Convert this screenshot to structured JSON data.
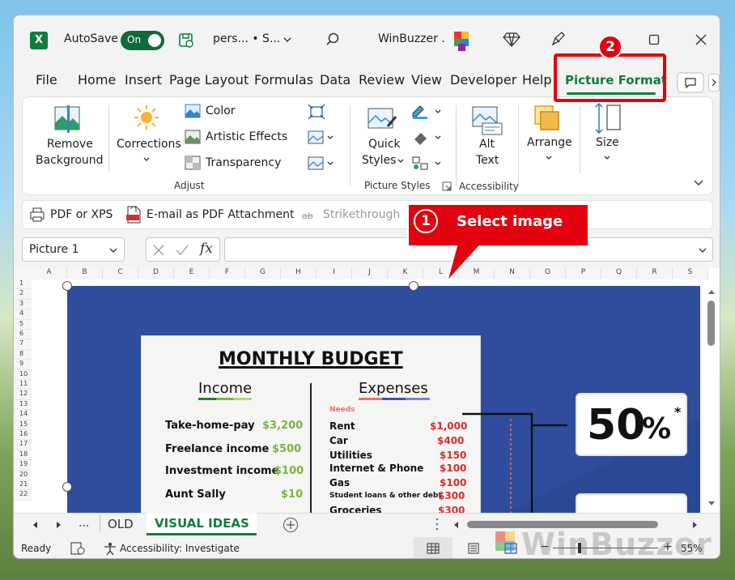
{
  "titlebar": {
    "app_icon": "X",
    "autosave_label": "AutoSave",
    "autosave_state": "On",
    "filename": "pers... • S...",
    "account": "WinBuzzer ."
  },
  "tabs": [
    {
      "label": "File"
    },
    {
      "label": "Home"
    },
    {
      "label": "Insert"
    },
    {
      "label": "Page Layout"
    },
    {
      "label": "Formulas"
    },
    {
      "label": "Data"
    },
    {
      "label": "Review"
    },
    {
      "label": "View"
    },
    {
      "label": "Developer"
    },
    {
      "label": "Help"
    },
    {
      "label": "Picture Format",
      "active": true
    }
  ],
  "ribbon": {
    "remove_background_1": "Remove",
    "remove_background_2": "Background",
    "corrections": "Corrections",
    "color": "Color",
    "artistic_effects": "Artistic Effects",
    "transparency": "Transparency",
    "group_adjust": "Adjust",
    "quick_styles_1": "Quick",
    "quick_styles_2": "Styles",
    "group_picture_styles": "Picture Styles",
    "alt_text_1": "Alt",
    "alt_text_2": "Text",
    "group_accessibility": "Accessibility",
    "arrange": "Arrange",
    "size": "Size"
  },
  "qat": {
    "pdf_xps": "PDF or XPS",
    "email_pdf": "E-mail as PDF Attachment",
    "strikethrough": "Strikethrough"
  },
  "formula_bar": {
    "name_box": "Picture 1",
    "fx": "fx",
    "value": ""
  },
  "grid": {
    "columns": [
      "A",
      "B",
      "C",
      "D",
      "E",
      "F",
      "G",
      "H",
      "I",
      "J",
      "K",
      "L",
      "M",
      "N",
      "O",
      "P",
      "Q",
      "R",
      "S"
    ],
    "rows": [
      "1",
      "2",
      "3",
      "4",
      "5",
      "6",
      "7",
      "8",
      "9",
      "10",
      "11",
      "12",
      "13",
      "14",
      "15",
      "16",
      "17",
      "18",
      "19",
      "20",
      "21",
      "22"
    ]
  },
  "image": {
    "title": "MONTHLY BUDGET",
    "income_header": "Income",
    "expenses_header": "Expenses",
    "needs_label": "Needs",
    "income": [
      {
        "label": "Take-home-pay",
        "value": "$3,200"
      },
      {
        "label": "Freelance income",
        "value": "$500"
      },
      {
        "label": "Investment income",
        "value": "$100"
      },
      {
        "label": "Aunt Sally",
        "value": "$10"
      }
    ],
    "expenses": [
      {
        "label": "Rent",
        "value": "$1,000"
      },
      {
        "label": "Car",
        "value": "$400"
      },
      {
        "label": "Utilities",
        "value": "$150"
      },
      {
        "label": "Internet & Phone",
        "value": "$100"
      },
      {
        "label": "Gas",
        "value": "$100"
      },
      {
        "label": "Student loans & other debt",
        "value": "$300"
      },
      {
        "label": "Groceries",
        "value": "$300"
      }
    ],
    "pct_main": "50",
    "pct_sym": "%",
    "pct_star": "*"
  },
  "annotations": {
    "step1_num": "1",
    "step1_text": "Select image",
    "step2_num": "2"
  },
  "sheet_tabs": {
    "ellipsis": "...",
    "tab1": "OLD",
    "tab2": "VISUAL IDEAS",
    "add": "+"
  },
  "status": {
    "ready": "Ready",
    "accessibility": "Accessibility: Investigate",
    "zoom": "55%",
    "minus": "−",
    "plus": "+"
  },
  "watermark": "WinBuzzer",
  "colors": {
    "excel_green": "#107c41",
    "annotation_red": "#e3000f",
    "poster_blue": "#2f4d9c",
    "income_green": "#7cb342",
    "expense_red": "#d32f2f"
  }
}
